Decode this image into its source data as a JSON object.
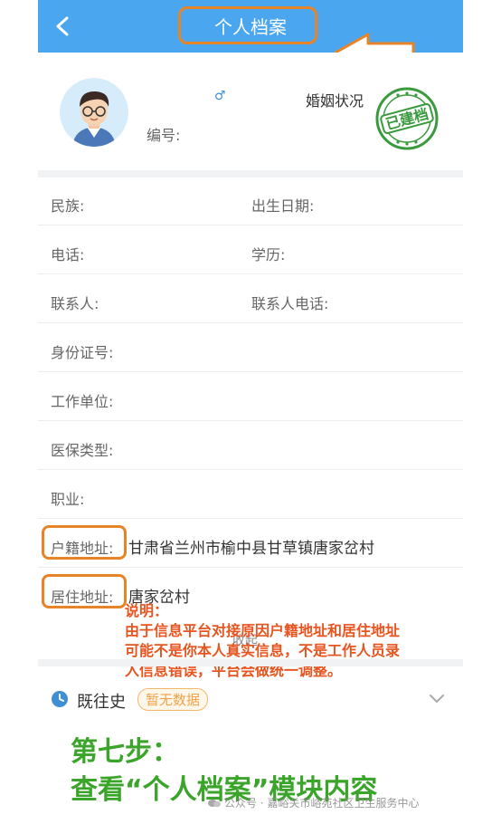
{
  "header": {
    "title": "个人档案"
  },
  "profile": {
    "gender_symbol": "♂",
    "marriage_label": "婚姻状况",
    "code_label": "编号:",
    "stamp_text": "已建档"
  },
  "fields": [
    {
      "label": "民族:",
      "label2": "出生日期:"
    },
    {
      "label": "电话:",
      "label2": "学历:"
    },
    {
      "label": "联系人:",
      "label2": "联系人电话:"
    },
    {
      "label": "身份证号:"
    },
    {
      "label": "工作单位:"
    },
    {
      "label": "医保类型:"
    },
    {
      "label": "职业:"
    },
    {
      "label": "户籍地址:",
      "value": "甘肃省兰州市榆中县甘草镇唐家岔村"
    },
    {
      "label": "居住地址:",
      "value": "唐家岔村"
    }
  ],
  "collapse_label": "收起",
  "note": {
    "title": "说明：",
    "lines": [
      "由于信息平台对接原因户籍地址和居住地址",
      "可能不是你本人真实信息，不是工作人员录",
      "入信息错误，平台会做统一调整。"
    ]
  },
  "history": {
    "label": "既往史",
    "badge": "暂无数据"
  },
  "step": {
    "line1": "第七步：",
    "line2": "查看“个人档案”模块内容"
  },
  "watermark": "公众号 · 嘉峪关市峪苑社区卫生服务中心",
  "colors": {
    "header": "#4aa7ef",
    "annotation": "#e88428",
    "note": "#e8541f",
    "step": "#3ba42a"
  }
}
